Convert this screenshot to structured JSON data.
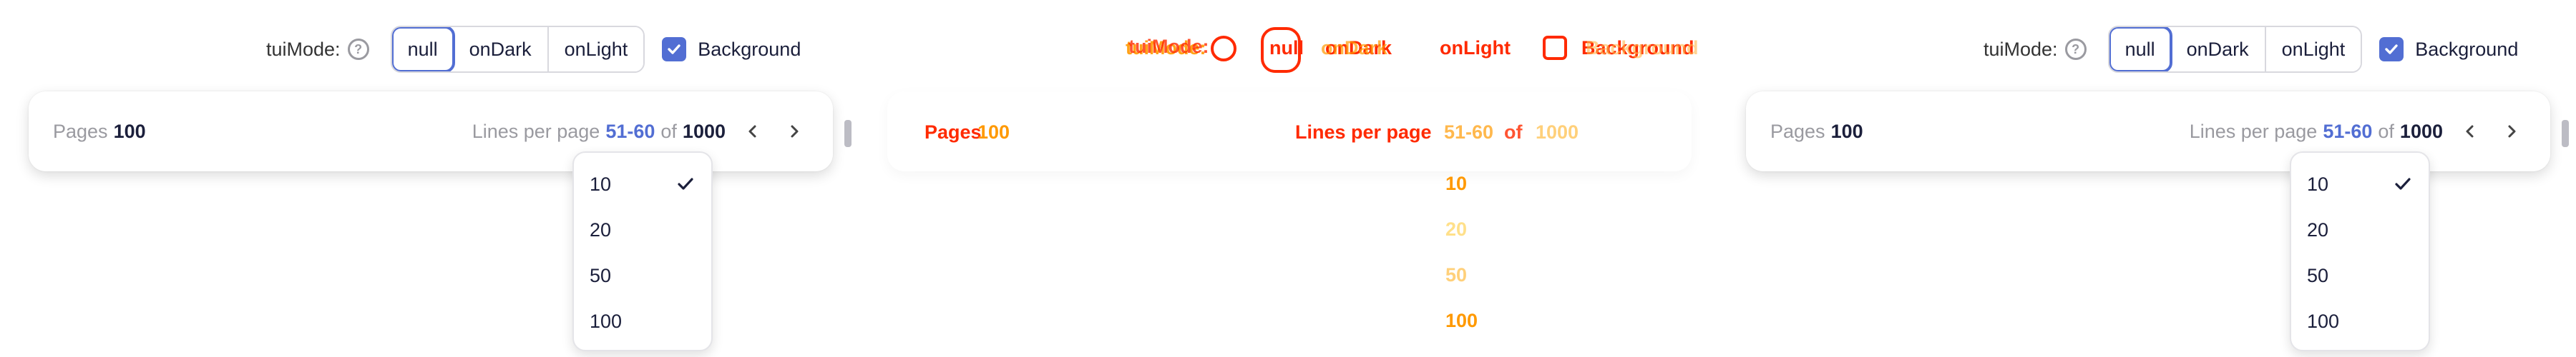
{
  "toolbar": {
    "mode_label": "tuiMode:",
    "help_icon": "question-circle-icon",
    "options": [
      "null",
      "onDark",
      "onLight"
    ],
    "selected": "null",
    "background_label": "Background",
    "background_checked": true
  },
  "pagination": {
    "pages_label": "Pages",
    "pages_value": "100",
    "lines_label": "Lines per page",
    "range": "51-60",
    "of_label": "of",
    "total": "1000"
  },
  "dropdown": {
    "items": [
      "10",
      "20",
      "50",
      "100"
    ],
    "selected": "10"
  },
  "colors": {
    "accent": "#526ed3",
    "diff_red": "#ff2a00",
    "diff_orange": "#ff9900",
    "diff_yellow": "#ffe08a"
  }
}
